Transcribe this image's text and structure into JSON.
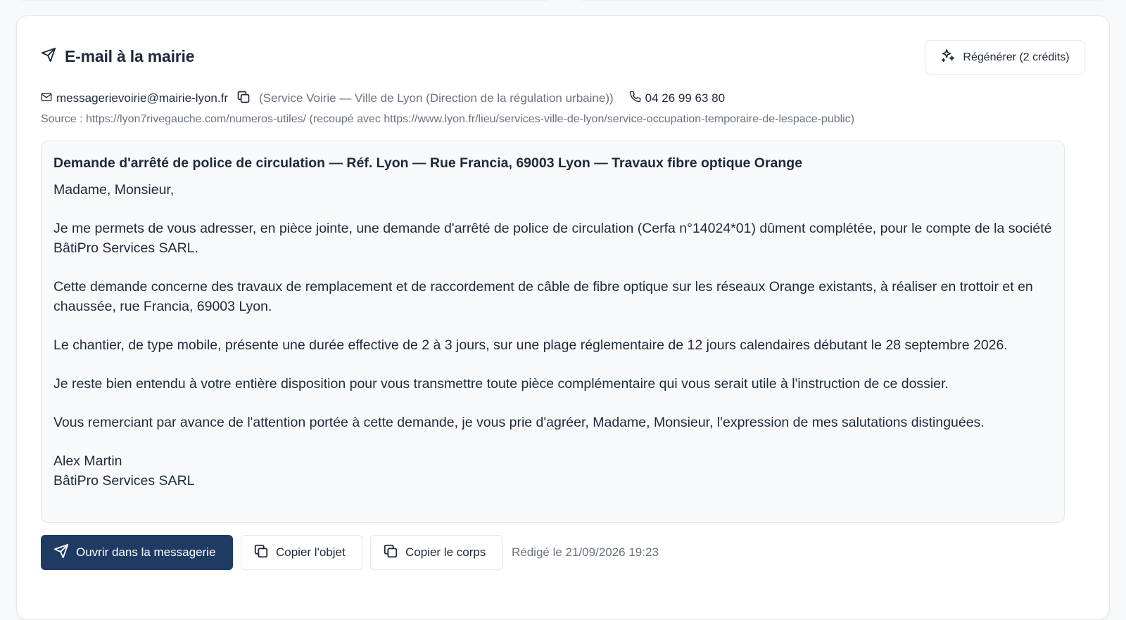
{
  "header": {
    "title": "E-mail à la mairie",
    "regenerate_label": "Régénérer (2 crédits)"
  },
  "contact": {
    "email": "messagerievoirie@mairie-lyon.fr",
    "service": "(Service Voirie — Ville de Lyon (Direction de la régulation urbaine))",
    "phone": "04 26 99 63 80"
  },
  "source": "Source : https://lyon7rivegauche.com/numeros-utiles/ (recoupé avec https://www.lyon.fr/lieu/services-ville-de-lyon/service-occupation-temporaire-de-lespace-public)",
  "email_content": {
    "subject": "Demande d'arrêté de police de circulation — Réf. Lyon — Rue Francia, 69003 Lyon — Travaux fibre optique Orange",
    "greeting": "Madame, Monsieur,",
    "paragraphs": [
      "Je me permets de vous adresser, en pièce jointe, une demande d'arrêté de police de circulation (Cerfa n°14024*01) dûment complétée, pour le compte de la société BâtiPro Services SARL.",
      "Cette demande concerne des travaux de remplacement et de raccordement de câble de fibre optique sur les réseaux Orange existants, à réaliser en trottoir et en chaussée, rue Francia, 69003 Lyon.",
      "Le chantier, de type mobile, présente une durée effective de 2 à 3 jours, sur une plage réglementaire de 12 jours calendaires débutant le 28 septembre 2026.",
      "Je reste bien entendu à votre entière disposition pour vous transmettre toute pièce complémentaire qui vous serait utile à l'instruction de ce dossier.",
      "Vous remerciant par avance de l'attention portée à cette demande, je vous prie d'agréer, Madame, Monsieur, l'expression de mes salutations distinguées."
    ],
    "signature_name": "Alex Martin",
    "signature_company": "BâtiPro Services SARL"
  },
  "footer": {
    "open_mail_label": "Ouvrir dans la messagerie",
    "copy_subject_label": "Copier l'objet",
    "copy_body_label": "Copier le corps",
    "drafted_text": "Rédigé le 21/09/2026 19:23"
  },
  "colors": {
    "primary": "#1f3b63",
    "text": "#1e2a3b",
    "muted": "#6b7280",
    "border": "#e4e7ec",
    "body_bg": "#f8f9fb"
  },
  "icons": {
    "title": "send-icon",
    "regenerate": "sparkles-icon",
    "email": "mail-icon",
    "copy": "copy-icon",
    "phone": "phone-icon"
  }
}
